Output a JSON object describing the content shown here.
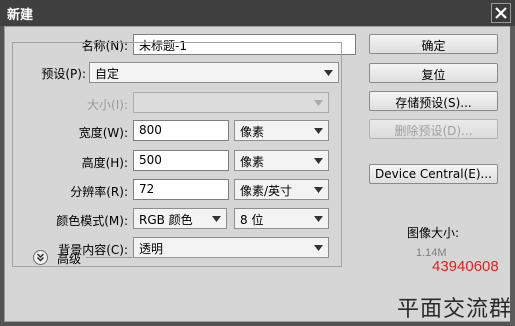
{
  "window": {
    "title": "新建"
  },
  "form": {
    "name_label": "名称(N):",
    "name_value": "未标题-1",
    "preset_label": "预设(P):",
    "preset_value": "自定",
    "size_label": "大小(I):",
    "size_value": "",
    "width_label": "宽度(W):",
    "width_value": "800",
    "width_unit": "像素",
    "height_label": "高度(H):",
    "height_value": "500",
    "height_unit": "像素",
    "resolution_label": "分辨率(R):",
    "resolution_value": "72",
    "resolution_unit": "像素/英寸",
    "color_mode_label": "颜色模式(M):",
    "color_mode_value": "RGB 颜色",
    "bit_depth_value": "8 位",
    "background_label": "背景内容(C):",
    "background_value": "透明",
    "advanced_label": "高级"
  },
  "buttons": {
    "ok": "确定",
    "reset": "复位",
    "save_preset": "存储预设(S)...",
    "delete_preset": "删除预设(D)...",
    "device_central": "Device Central(E)..."
  },
  "image_size": {
    "label": "图像大小:",
    "value": "1.14M"
  },
  "watermark": {
    "number": "43940608",
    "text": "平面交流群"
  },
  "colors": {
    "window_bg": "#535353",
    "panel_bg": "#d6d6d6",
    "watermark_red": "#e02020"
  }
}
